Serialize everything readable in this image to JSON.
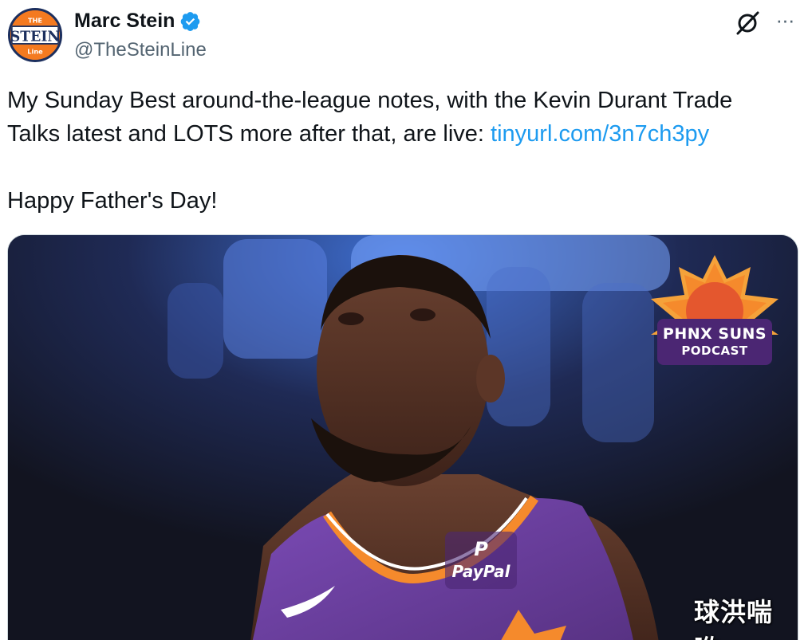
{
  "author": {
    "display_name": "Marc Stein",
    "handle": "@TheSteinLine",
    "avatar": {
      "top_text": "THE",
      "main_text": "STEIN",
      "bottom_text": "Line",
      "colors": {
        "ring": "#1c2f5e",
        "fill": "#f47a20"
      }
    },
    "verified_icon": "verified-badge-icon",
    "verified_color": "#1d9bf0"
  },
  "header_actions": {
    "grok_icon": "grok-slash-icon",
    "more_icon": "more-options-icon",
    "more_glyph": "···"
  },
  "tweet": {
    "line1": "My Sunday Best around-the-league notes, with the Kevin Durant Trade",
    "line2_text": "Talks latest and LOTS more after that, are live: ",
    "link": "tinyurl.com/3n7ch3py",
    "line3": "Happy Father's Day!"
  },
  "media": {
    "badge_title": "PHNX SUNS",
    "badge_sub": "PODCAST",
    "sponsor_logo": "P",
    "sponsor_text": "PayPal",
    "watermark": "球洪喘哟",
    "colors": {
      "jersey": "#6b3fa0",
      "trim": "#f58a2c",
      "badge_purple": "#4b2673"
    }
  },
  "colors": {
    "text": "#0f1419",
    "secondary": "#536471",
    "link": "#1d9bf0"
  }
}
